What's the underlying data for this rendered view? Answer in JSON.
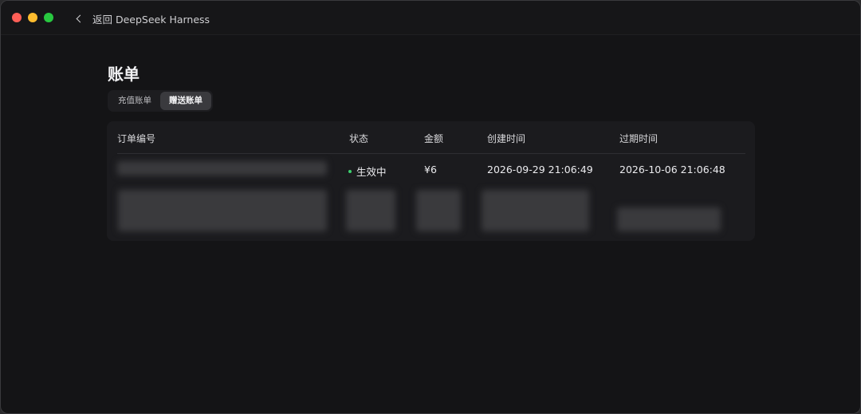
{
  "header": {
    "back_label": "返回 DeepSeek Harness"
  },
  "page": {
    "title": "账单"
  },
  "tabs": [
    {
      "label": "充值账单",
      "active": false
    },
    {
      "label": "赠送账单",
      "active": true
    }
  ],
  "table": {
    "columns": [
      "订单编号",
      "状态",
      "金额",
      "创建时间",
      "过期时间"
    ],
    "rows": [
      {
        "status": "生效中",
        "amount": "¥6",
        "created": "2026-09-29 21:06:49",
        "expires": "2026-10-06 21:06:48"
      }
    ]
  },
  "colors": {
    "status_active": "#3ccf6e",
    "background": "#141416"
  }
}
